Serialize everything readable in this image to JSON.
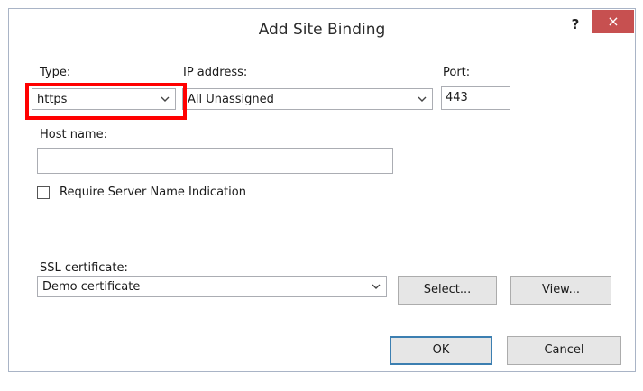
{
  "dialog": {
    "title": "Add Site Binding",
    "help_label": "?",
    "close_label": "×"
  },
  "type": {
    "label": "Type:",
    "value": "https"
  },
  "ip_address": {
    "label": "IP address:",
    "value": "All Unassigned"
  },
  "port": {
    "label": "Port:",
    "value": "443"
  },
  "host_name": {
    "label": "Host name:",
    "value": ""
  },
  "sni": {
    "label": "Require Server Name Indication",
    "checked": false
  },
  "ssl": {
    "label": "SSL certificate:",
    "value": "Demo certificate",
    "select_button": "Select...",
    "view_button": "View..."
  },
  "actions": {
    "ok": "OK",
    "cancel": "Cancel"
  },
  "colors": {
    "highlight": "#ff0000",
    "close_button": "#c75050",
    "default_button_border": "#3c7fb1"
  },
  "icons": {
    "dropdown": "chevron-down-icon",
    "close": "close-icon",
    "help": "help-icon"
  }
}
